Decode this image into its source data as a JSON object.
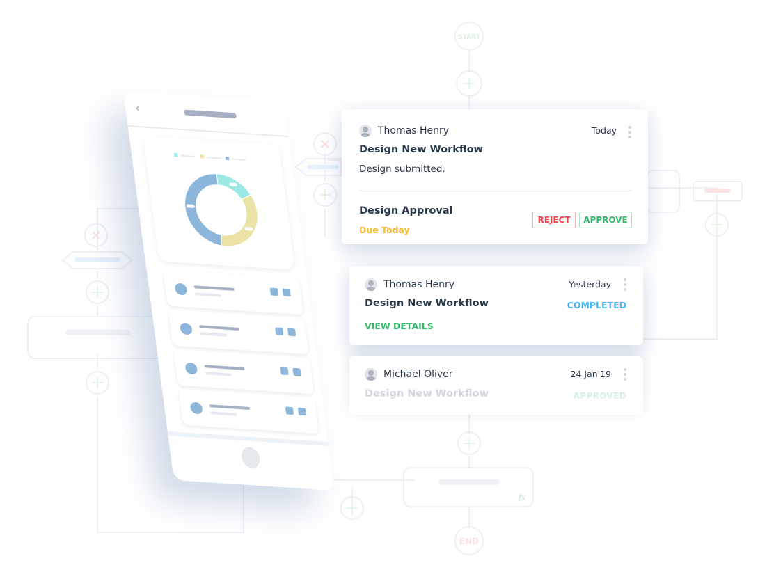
{
  "flow": {
    "start_label": "START",
    "end_label": "END",
    "fx_label": "fx"
  },
  "phone": {
    "chart_data": {
      "type": "pie",
      "values": [
        17,
        35,
        48
      ],
      "colors": [
        "#9ae9e4",
        "#ebe2a6",
        "#8db6db"
      ]
    },
    "list_items": 4
  },
  "cards": [
    {
      "user": "Thomas Henry",
      "date": "Today",
      "title": "Design New Workflow",
      "message": "Design submitted.",
      "task": "Design Approval",
      "due": "Due Today",
      "reject": "REJECT",
      "approve": "APPROVE"
    },
    {
      "user": "Thomas Henry",
      "date": "Yesterday",
      "title": "Design New Workflow",
      "status": "COMPLETED",
      "link": "VIEW DETAILS"
    },
    {
      "user": "Michael Oliver",
      "date": "24 Jan'19",
      "title": "Design New Workflow",
      "status": "APPROVED"
    }
  ],
  "colors": {
    "reject": "#f0424b",
    "approve": "#34b86a",
    "due": "#f7b928",
    "completed": "#3fb7f5",
    "text": "#2b3a4a"
  }
}
